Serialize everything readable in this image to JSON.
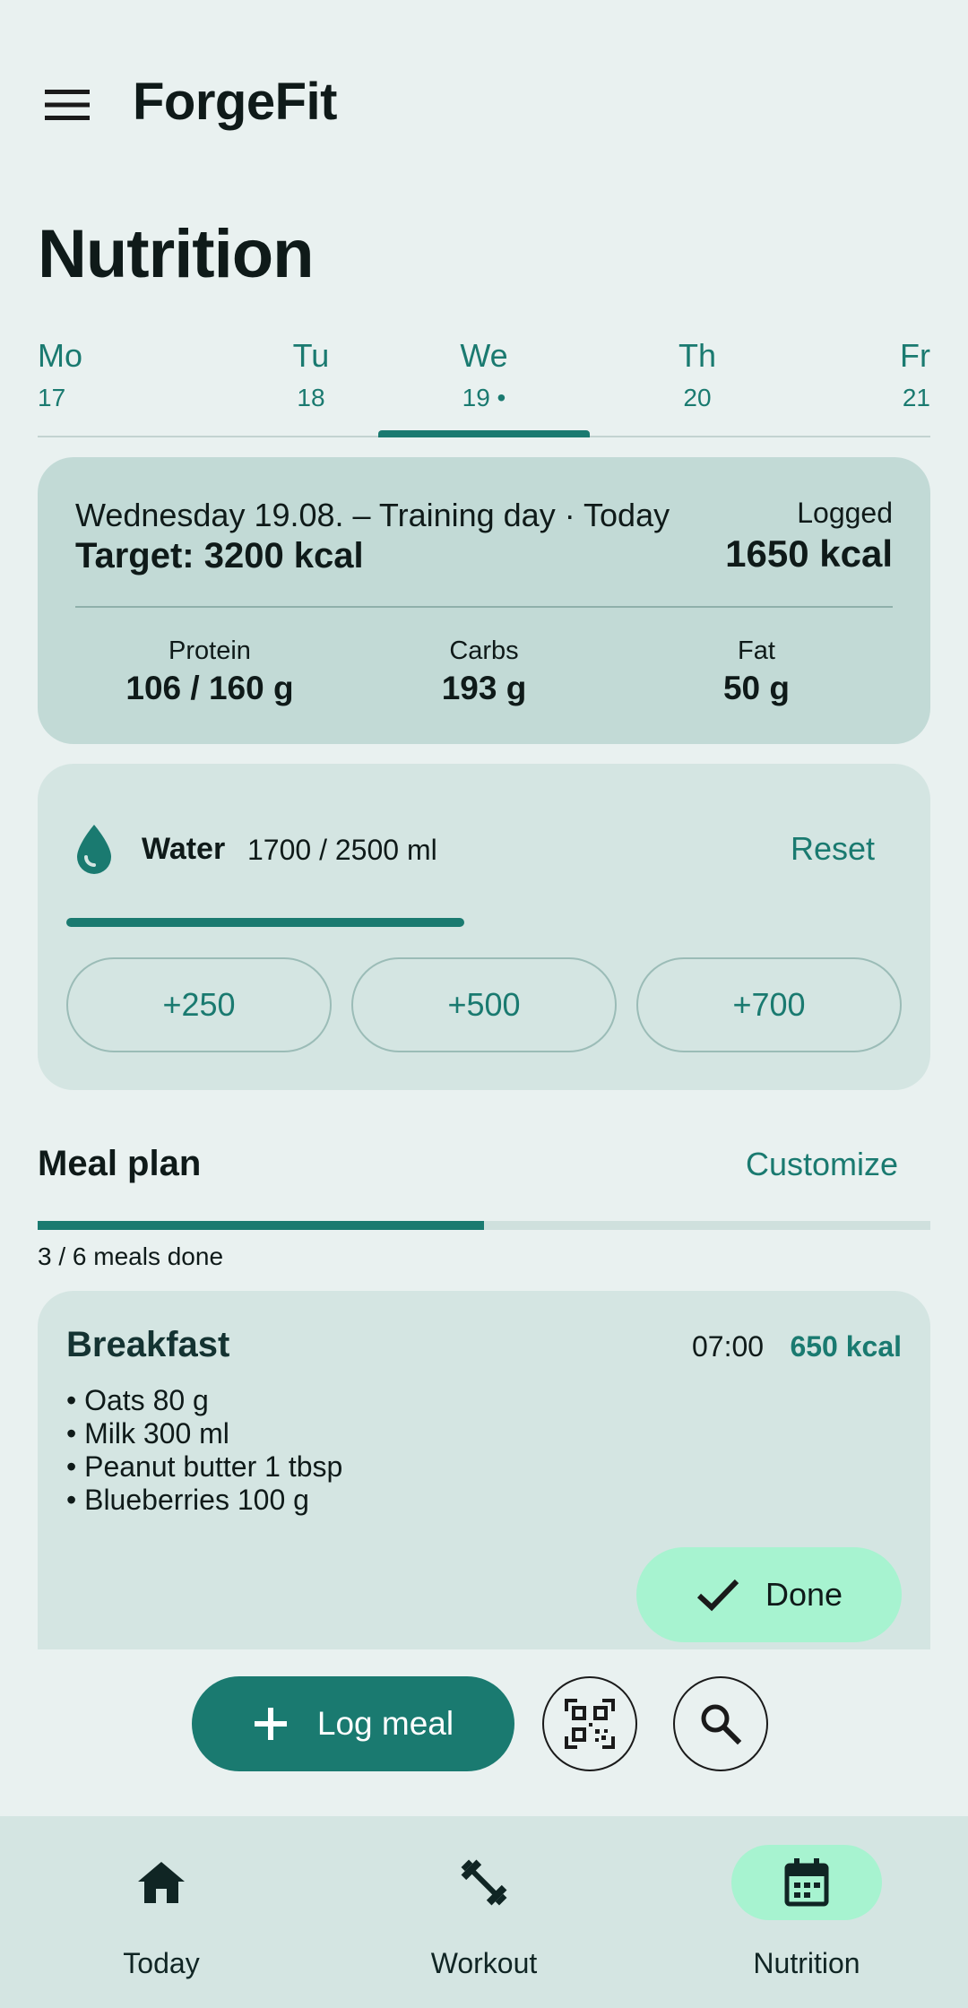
{
  "app": {
    "title": "ForgeFit"
  },
  "page": {
    "title": "Nutrition"
  },
  "days": [
    {
      "name": "Mo",
      "date": "17"
    },
    {
      "name": "Tu",
      "date": "18"
    },
    {
      "name": "We",
      "date": "19 •"
    },
    {
      "name": "Th",
      "date": "20"
    },
    {
      "name": "Fr",
      "date": "21"
    }
  ],
  "selected_day_index": 2,
  "summary": {
    "headline": "Wednesday 19.08. – Training day · Today",
    "target": "Target: 3200 kcal",
    "logged_label": "Logged",
    "logged_value": "1650 kcal",
    "macros": [
      {
        "label": "Protein",
        "value": "106 / 160 g"
      },
      {
        "label": "Carbs",
        "value": "193 g"
      },
      {
        "label": "Fat",
        "value": "50 g"
      }
    ]
  },
  "water": {
    "label": "Water",
    "value": "1700 / 2500 ml",
    "progress": 0.476,
    "reset_label": "Reset",
    "quick_add": [
      "+250",
      "+500",
      "+700"
    ],
    "icon": "water-drop-icon"
  },
  "meal_plan": {
    "title": "Meal plan",
    "customize_label": "Customize",
    "progress": 0.5,
    "count_text": "3 / 6 meals done"
  },
  "meal": {
    "name": "Breakfast",
    "time": "07:00",
    "kcal": "650 kcal",
    "items": [
      "• Oats  80 g",
      "• Milk  300 ml",
      "• Peanut butter  1 tbsp",
      "• Blueberries  100 g"
    ],
    "done_label": "Done"
  },
  "actions": {
    "log_meal_label": "Log meal",
    "scan_icon": "qr-code-scan-icon",
    "search_icon": "search-icon"
  },
  "bottom_nav": [
    {
      "label": "Today",
      "icon": "home-icon"
    },
    {
      "label": "Workout",
      "icon": "dumbbell-icon"
    },
    {
      "label": "Nutrition",
      "icon": "calendar-icon"
    }
  ],
  "colors": {
    "accent": "#1a7a70",
    "background": "#e9f1f0",
    "summary_card": "#c2dad6",
    "card": "#d4e5e2",
    "done_pill": "#a7f3d0"
  }
}
